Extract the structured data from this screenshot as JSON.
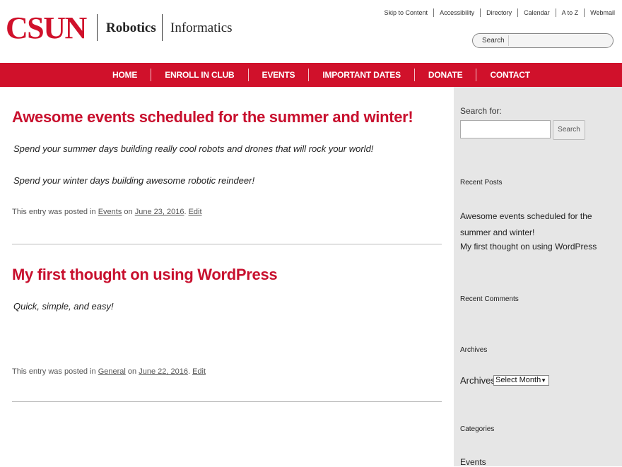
{
  "header": {
    "logo": "CSUN",
    "dept1": "Robotics",
    "dept2": "Informatics",
    "utility_links": [
      "Skip to Content",
      "Accessibility",
      "Directory",
      "Calendar",
      "A to Z",
      "Webmail"
    ],
    "search_label": "Search"
  },
  "nav": {
    "items": [
      "HOME",
      "ENROLL IN CLUB",
      "EVENTS",
      "IMPORTANT DATES",
      "DONATE",
      "CONTACT"
    ]
  },
  "posts": [
    {
      "title": "Awesome events scheduled for the summer and winter!",
      "lines": [
        "Spend your summer days building really cool robots and drones that will rock your world!",
        "Spend your winter days building awesome robotic reindeer!"
      ],
      "meta_prefix": "This entry was posted in",
      "category": "Events",
      "meta_on": "on",
      "date": "June 23, 2016",
      "edit": "Edit"
    },
    {
      "title": "My first thought on using WordPress",
      "lines": [
        "Quick, simple, and easy!"
      ],
      "meta_prefix": "This entry was posted in",
      "category": "General",
      "meta_on": "on",
      "date": "June 22, 2016",
      "edit": "Edit"
    }
  ],
  "sidebar": {
    "search_for": "Search for:",
    "search_button": "Search",
    "recent_posts_heading": "Recent Posts",
    "recent_posts": [
      "Awesome events scheduled for the summer and winter!",
      "My first thought on using WordPress"
    ],
    "recent_comments_heading": "Recent Comments",
    "archives_heading": "Archives",
    "archives_label": "Archives",
    "archives_select": "Select Month",
    "categories_heading": "Categories",
    "categories": [
      "Events"
    ]
  },
  "colors": {
    "brand_red": "#d0112b",
    "sidebar_bg": "#e6e6e6"
  }
}
